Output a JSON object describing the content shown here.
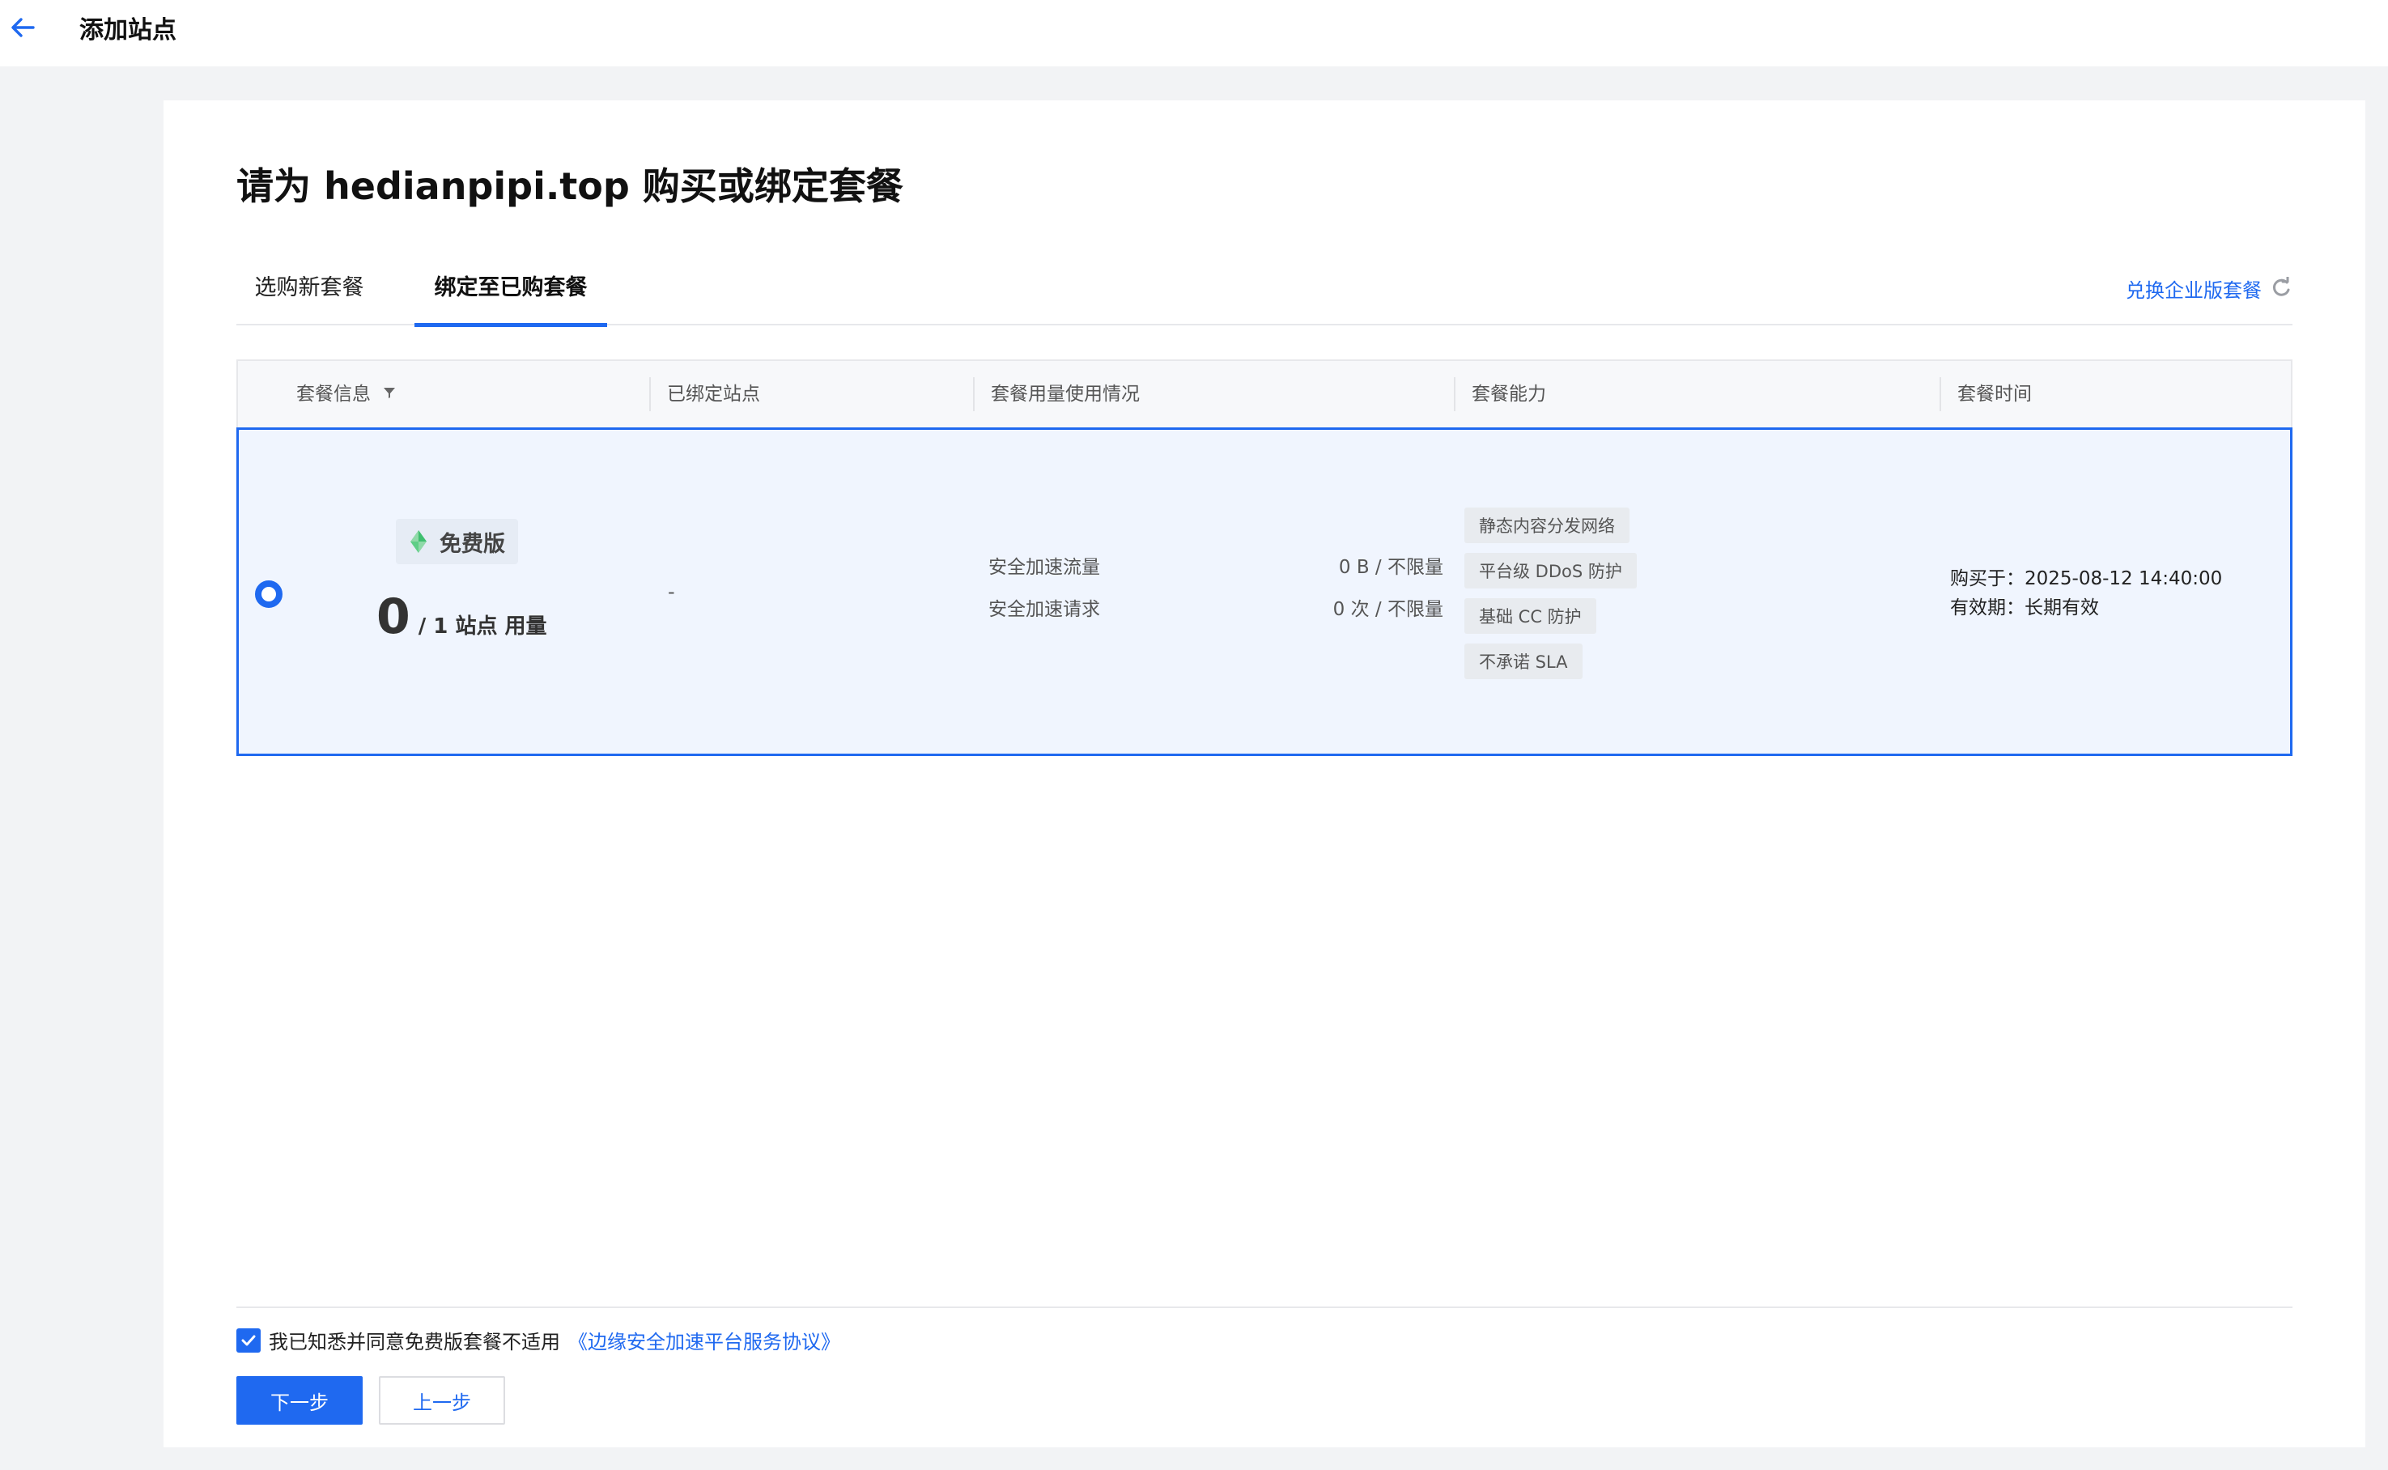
{
  "topbar": {
    "title": "添加站点"
  },
  "heading": "请为 hedianpipi.top 购买或绑定套餐",
  "tabs": [
    {
      "label": "选购新套餐",
      "active": false
    },
    {
      "label": "绑定至已购套餐",
      "active": true
    }
  ],
  "redeem_link": "兑换企业版套餐",
  "table": {
    "headers": [
      "套餐信息",
      "已绑定站点",
      "套餐用量使用情况",
      "套餐能力",
      "套餐时间"
    ],
    "row": {
      "selected": true,
      "plan_name": "免费版",
      "used_sites": "0",
      "site_quota": "/ 1 站点 用量",
      "bound_sites": "-",
      "metrics": [
        {
          "label": "安全加速流量",
          "value": "0 B / 不限量"
        },
        {
          "label": "安全加速请求",
          "value": "0 次 / 不限量"
        }
      ],
      "capabilities": [
        "静态内容分发网络",
        "平台级 DDoS 防护",
        "基础 CC 防护",
        "不承诺 SLA"
      ],
      "purchase_label": "购买于：",
      "purchase_time": "2025-08-12 14:40:00",
      "validity_label": "有效期：",
      "validity_value": "长期有效"
    }
  },
  "agreement": {
    "checked": true,
    "text": "我已知悉并同意免费版套餐不适用",
    "link": "《边缘安全加速平台服务协议》"
  },
  "buttons": {
    "next": "下一步",
    "prev": "上一步"
  },
  "colors": {
    "accent": "#1f69f0",
    "selected_row_bg": "#f0f5fe"
  }
}
